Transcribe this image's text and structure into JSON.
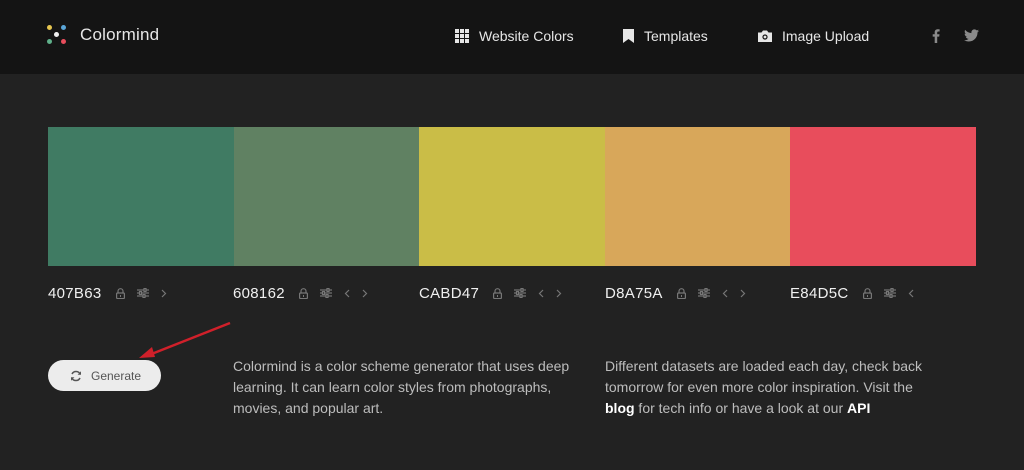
{
  "brand": {
    "name": "Colormind"
  },
  "nav": {
    "website_colors": "Website Colors",
    "templates": "Templates",
    "image_upload": "Image Upload"
  },
  "palette": [
    {
      "hex": "407B63",
      "color": "#407B63"
    },
    {
      "hex": "608162",
      "color": "#608162"
    },
    {
      "hex": "CABD47",
      "color": "#CABD47"
    },
    {
      "hex": "D8A75A",
      "color": "#D8A75A"
    },
    {
      "hex": "E84D5C",
      "color": "#E84D5C"
    }
  ],
  "generate": {
    "label": "Generate"
  },
  "description": {
    "left": "Colormind is a color scheme generator that uses deep learning. It can learn color styles from photographs, movies, and popular art.",
    "right_pre": "Different datasets are loaded each day, check back tomorrow for even more color inspiration. Visit the ",
    "blog": "blog",
    "right_mid": " for tech info or have a look at our ",
    "api": "API"
  },
  "icons": {
    "website_colors": "grid-icon",
    "templates": "bookmark-icon",
    "image_upload": "camera-icon",
    "facebook": "facebook-icon",
    "twitter": "twitter-icon",
    "lock": "lock-icon",
    "adjust": "sliders-icon",
    "left": "chevron-left-icon",
    "right": "chevron-right-icon",
    "generate": "refresh-icon"
  },
  "colors": {
    "background": "#222222",
    "header": "#141414",
    "annotation_arrow": "#d0202a"
  }
}
